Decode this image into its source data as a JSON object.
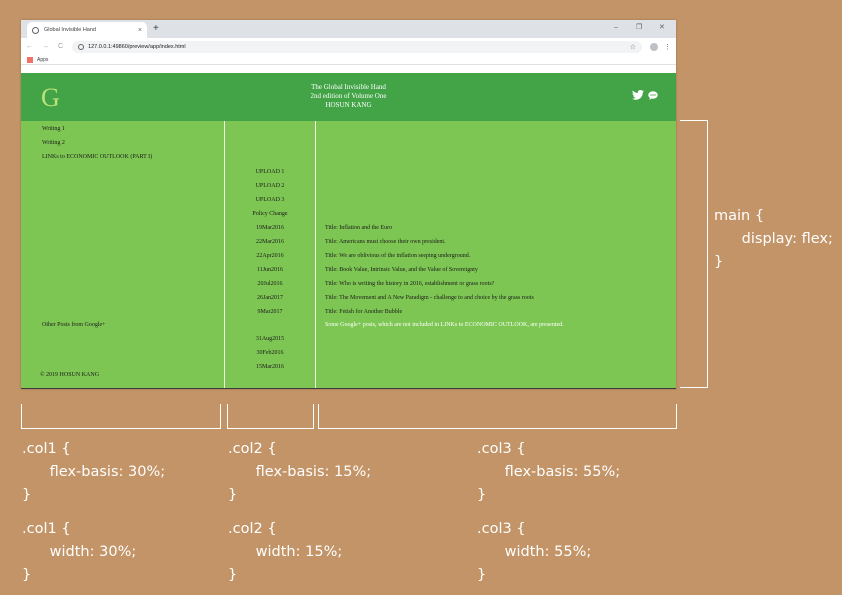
{
  "browser": {
    "tab_title": "Global Invisible Hand",
    "tab_close": "×",
    "new_tab": "+",
    "minimize": "–",
    "restore": "❐",
    "close": "✕",
    "back": "←",
    "forward": "→",
    "reload": "C",
    "url": "127.0.0.1:49860/preview/app/index.html",
    "bookmark_star": "☆",
    "menu": "⋮",
    "bookmarks_apps": "Apps"
  },
  "site": {
    "logo": "G",
    "header_lines": [
      "The Global Invisible Hand",
      "2nd edition of Volume One",
      "HOSUN KANG"
    ],
    "icons": [
      "twitter-icon",
      "chat-bubble-icon"
    ]
  },
  "col1": {
    "links": [
      "Writing 1",
      "Writing 2",
      "LINKs to ECONOMIC OUTLOOK (PART I)"
    ],
    "other_posts": "Other Posts from Google+",
    "copyright": "© 2019 HOSUN KANG"
  },
  "col2": {
    "uploads": [
      "UPLOAD 1",
      "UPLOAD 2",
      "UPLOAD 3"
    ],
    "policy_change": "Policy Change",
    "dates": [
      "19Mar2016",
      "22Mar2016",
      "22Apr2016",
      "11Jun2016",
      "20Jul2016",
      "26Jan2017",
      "9Mar2017"
    ],
    "old_dates": [
      "31Aug2015",
      "30Feb2016",
      "15Mar2016"
    ]
  },
  "col3": {
    "titles": [
      "Title: Inflation and the Euro",
      "Title: Americans must choose their own president.",
      "Title: We are oblivious of the inflation seeping underground.",
      "Title: Book Value, Intrinsic Value, and the Value of Sovereignty",
      "Title: Who is writing the history in 2016, establishment or grass roots?",
      "Title: The Movement and A New Paradigm - challenge to and choice by the grass roots",
      "Title: Fetish for Another Bubble"
    ],
    "note": "Some Google+ posts, which are not included in LINKs to ECONOMIC OUTLOOK, are presented."
  },
  "annotations": {
    "main_css": "main {\n      display: flex;\n}",
    "col1_flex": ".col1 {\n      flex-basis: 30%;\n}",
    "col2_flex": ".col2 {\n      flex-basis: 15%;\n}",
    "col3_flex": ".col3 {\n      flex-basis: 55%;\n}",
    "col1_width": ".col1 {\n      width: 30%;\n}",
    "col2_width": ".col2 {\n      width: 15%;\n}",
    "col3_width": ".col3 {\n      width: 55%;\n}"
  },
  "colors": {
    "background": "#c39467",
    "header_green": "#42a447",
    "main_green": "#7ec653"
  }
}
